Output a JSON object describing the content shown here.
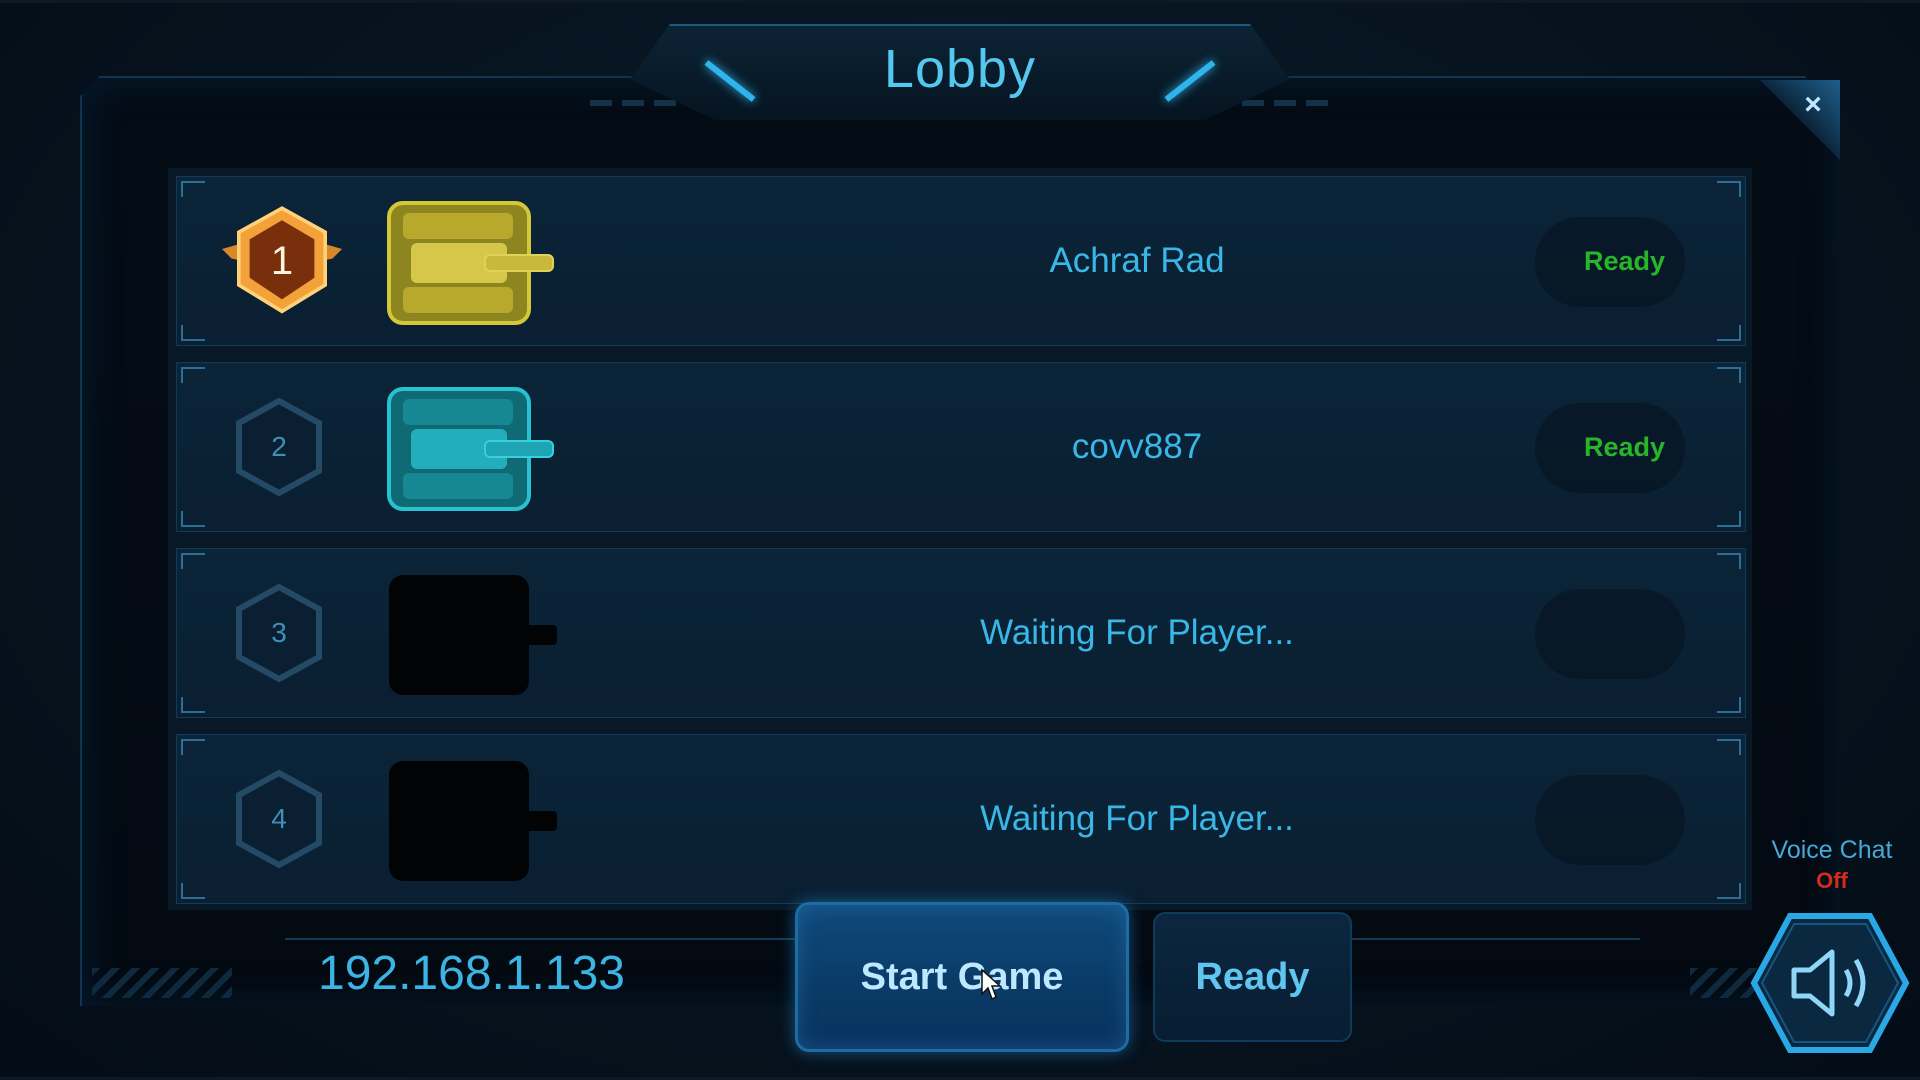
{
  "lobby": {
    "title": "Lobby",
    "close_label": "×",
    "players": [
      {
        "rank": "1",
        "name": "Achraf Rad",
        "status": "Ready",
        "tank_color": "#c8b830"
      },
      {
        "rank": "2",
        "name": "covv887",
        "status": "Ready",
        "tank_color": "#1eb8c4"
      },
      {
        "rank": "3",
        "name": "Waiting For Player...",
        "status": "",
        "tank_color": "#000000"
      },
      {
        "rank": "4",
        "name": "Waiting For Player...",
        "status": "",
        "tank_color": "#000000"
      }
    ]
  },
  "footer": {
    "ip_address": "192.168.1.133",
    "start_label": "Start Game",
    "ready_label": "Ready",
    "voice_chat_label": "Voice Chat",
    "voice_chat_state": "Off"
  },
  "colors": {
    "accent": "#39b7e8",
    "ready": "#27b52a",
    "gold": "#e8861c",
    "off": "#d52a1e"
  },
  "icons": {
    "close": "close-icon",
    "rank_gold": "gold-rank-badge-icon",
    "rank_plain": "hexagon-rank-icon",
    "tank": "tank-icon",
    "speaker": "speaker-icon",
    "cursor": "mouse-cursor-icon"
  }
}
